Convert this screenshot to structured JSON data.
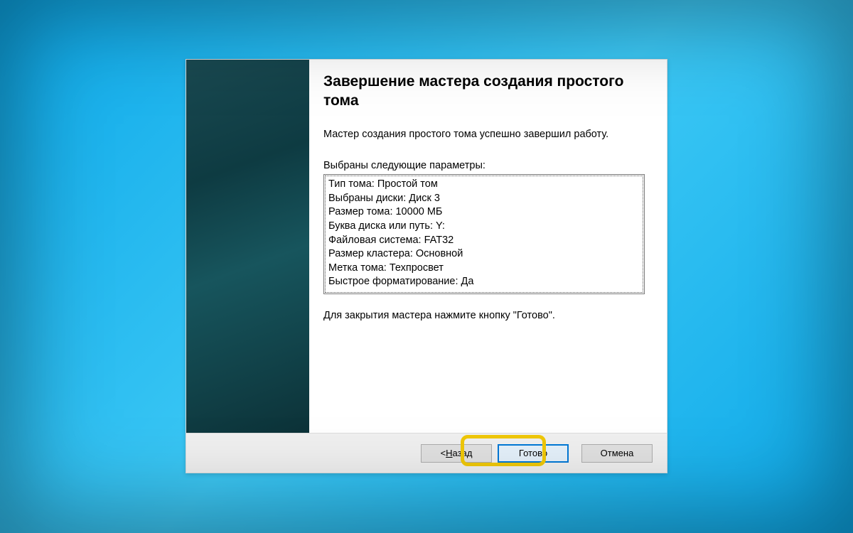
{
  "wizard": {
    "title": "Завершение мастера создания простого тома",
    "description": "Мастер создания простого тома успешно завершил работу.",
    "params_label": "Выбраны следующие параметры:",
    "params": [
      "Тип тома: Простой том",
      "Выбраны диски: Диск 3",
      "Размер тома: 10000 МБ",
      "Буква диска или путь: Y:",
      "Файловая система: FAT32",
      "Размер кластера: Основной",
      "Метка тома: Техпросвет",
      "Быстрое форматирование: Да"
    ],
    "close_hint": "Для закрытия мастера нажмите кнопку \"Готово\"."
  },
  "buttons": {
    "back_prefix": "< ",
    "back_mnemonic": "Н",
    "back_rest": "азад",
    "finish": "Готово",
    "cancel": "Отмена"
  }
}
